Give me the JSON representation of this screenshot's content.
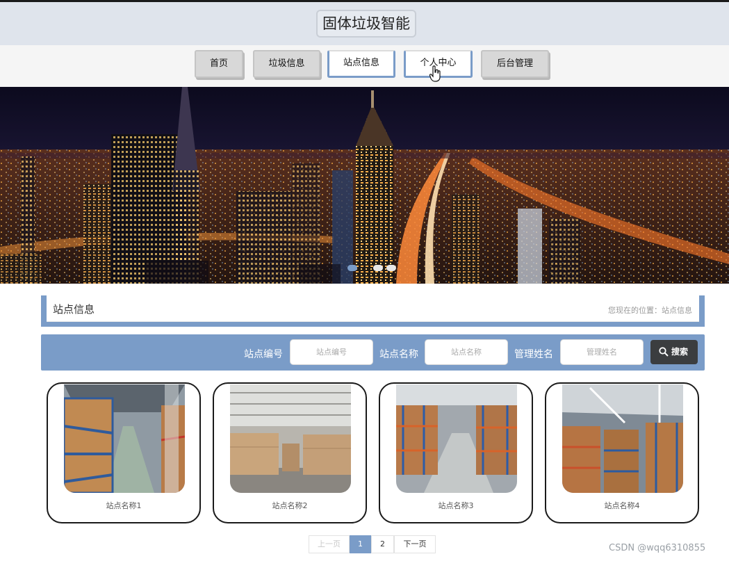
{
  "header": {
    "site_title": "固体垃圾智能"
  },
  "nav": {
    "items": [
      {
        "label": "首页"
      },
      {
        "label": "垃圾信息"
      },
      {
        "label": "站点信息"
      },
      {
        "label": "个人中心"
      },
      {
        "label": "后台管理"
      }
    ],
    "active_index": 2
  },
  "breadcrumb": {
    "title": "站点信息",
    "location": "您现在的位置：站点信息"
  },
  "search": {
    "field1_label": "站点编号",
    "field1_placeholder": "站点编号",
    "field2_label": "站点名称",
    "field2_placeholder": "站点名称",
    "field3_label": "管理姓名",
    "field3_placeholder": "管理姓名",
    "button_label": "搜索"
  },
  "cards": [
    {
      "name": "站点名称1"
    },
    {
      "name": "站点名称2"
    },
    {
      "name": "站点名称3"
    },
    {
      "name": "站点名称4"
    }
  ],
  "pagination": {
    "prev": "上一页",
    "pages": [
      "1",
      "2"
    ],
    "current": "1",
    "next": "下一页"
  },
  "watermark": "CSDN @wqq6310855",
  "colors": {
    "accent": "#7a9cc8",
    "search_button": "#3b3d3f"
  }
}
